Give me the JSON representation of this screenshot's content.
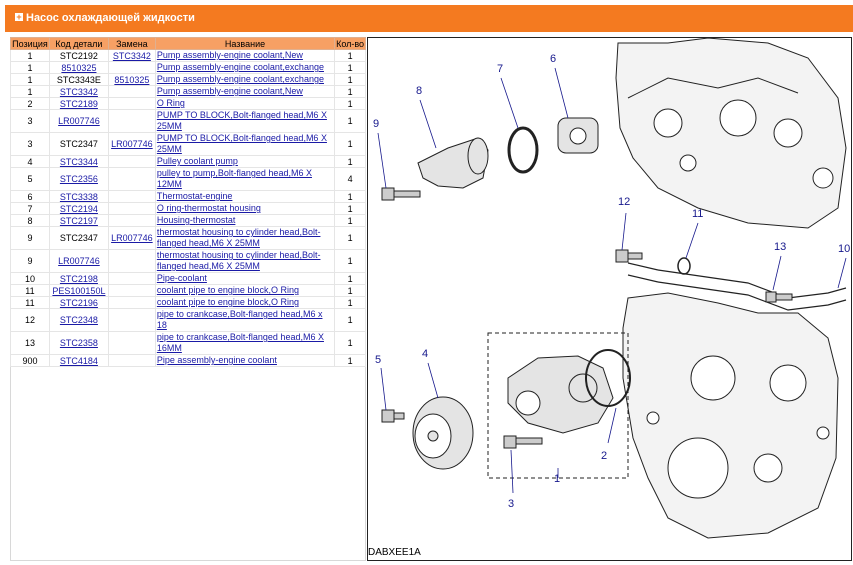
{
  "header": {
    "title": "Насос охлаждающей жидкости",
    "toggle_icon": "plus-icon"
  },
  "table": {
    "columns": [
      "Позиция",
      "Код детали",
      "Замена",
      "Название",
      "Кол-во"
    ],
    "rows": [
      {
        "pos": "1",
        "code": "STC2192",
        "code_link": false,
        "repl": "STC3342",
        "name": "Pump assembly-engine coolant,New",
        "qty": "1"
      },
      {
        "pos": "1",
        "code": "8510325",
        "code_link": true,
        "repl": "",
        "name": "Pump assembly-engine coolant,exchange",
        "qty": "1"
      },
      {
        "pos": "1",
        "code": "STC3343E",
        "code_link": false,
        "repl": "8510325",
        "name": "Pump assembly-engine coolant,exchange",
        "qty": "1"
      },
      {
        "pos": "1",
        "code": "STC3342",
        "code_link": true,
        "repl": "",
        "name": "Pump assembly-engine coolant,New",
        "qty": "1"
      },
      {
        "pos": "2",
        "code": "STC2189",
        "code_link": true,
        "repl": "",
        "name": "O Ring",
        "qty": "1"
      },
      {
        "pos": "3",
        "code": "LR007746",
        "code_link": true,
        "repl": "",
        "name": "PUMP TO BLOCK,Bolt-flanged head,M6 X 25MM",
        "qty": "1"
      },
      {
        "pos": "3",
        "code": "STC2347",
        "code_link": false,
        "repl": "LR007746",
        "name": "PUMP TO BLOCK,Bolt-flanged head,M6 X 25MM",
        "qty": "1"
      },
      {
        "pos": "4",
        "code": "STC3344",
        "code_link": true,
        "repl": "",
        "name": "Pulley coolant pump",
        "qty": "1"
      },
      {
        "pos": "5",
        "code": "STC2356",
        "code_link": true,
        "repl": "",
        "name": "pulley to pump,Bolt-flanged head,M6 X 12MM",
        "qty": "4"
      },
      {
        "pos": "6",
        "code": "STC3338",
        "code_link": true,
        "repl": "",
        "name": "Thermostat-engine",
        "qty": "1"
      },
      {
        "pos": "7",
        "code": "STC2194",
        "code_link": true,
        "repl": "",
        "name": "O ring-thermostat housing",
        "qty": "1"
      },
      {
        "pos": "8",
        "code": "STC2197",
        "code_link": true,
        "repl": "",
        "name": "Housing-thermostat",
        "qty": "1"
      },
      {
        "pos": "9",
        "code": "STC2347",
        "code_link": false,
        "repl": "LR007746",
        "name": "thermostat housing to cylinder head,Bolt-flanged head,M6 X 25MM",
        "qty": "1"
      },
      {
        "pos": "9",
        "code": "LR007746",
        "code_link": true,
        "repl": "",
        "name": "thermostat housing to cylinder head,Bolt-flanged head,M6 X 25MM",
        "qty": "1"
      },
      {
        "pos": "10",
        "code": "STC2198",
        "code_link": true,
        "repl": "",
        "name": "Pipe-coolant",
        "qty": "1"
      },
      {
        "pos": "11",
        "code": "PES100150L",
        "code_link": true,
        "repl": "",
        "name": "coolant pipe to engine block,O Ring",
        "qty": "1"
      },
      {
        "pos": "11",
        "code": "STC2196",
        "code_link": true,
        "repl": "",
        "name": "coolant pipe to engine block,O Ring",
        "qty": "1"
      },
      {
        "pos": "12",
        "code": "STC2348",
        "code_link": true,
        "repl": "",
        "name": "pipe to crankcase,Bolt-flanged head,M6 x 18",
        "qty": "1"
      },
      {
        "pos": "13",
        "code": "STC2358",
        "code_link": true,
        "repl": "",
        "name": "pipe to crankcase,Bolt-flanged head,M6 X 16MM",
        "qty": "1"
      },
      {
        "pos": "900",
        "code": "STC4184",
        "code_link": true,
        "repl": "",
        "name": "Pipe assembly-engine coolant",
        "qty": "1"
      }
    ]
  },
  "diagram": {
    "code": "DABXEE1A",
    "labels": [
      "1",
      "2",
      "3",
      "4",
      "5",
      "6",
      "7",
      "8",
      "9",
      "10",
      "11",
      "12",
      "13"
    ]
  },
  "colors": {
    "header": "#f47a20",
    "table_header": "#f7a064",
    "link": "#1a1aa6",
    "callout": "#16188c"
  }
}
